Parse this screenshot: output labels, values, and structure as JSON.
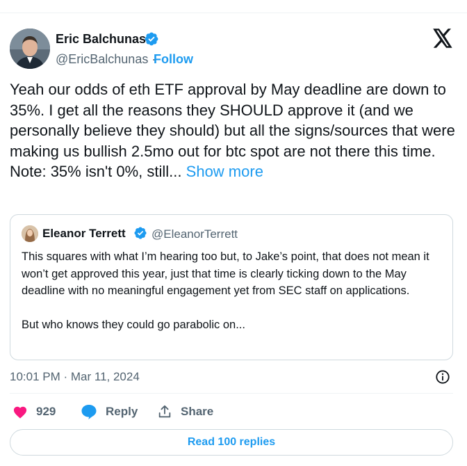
{
  "colors": {
    "accent": "#1d9bf0",
    "text": "#0f1419",
    "secondary": "#536471",
    "like": "#f91880",
    "border": "#cfd9de"
  },
  "author": {
    "name": "Eric Balchunas",
    "handle": "@EricBalchunas",
    "separator": "·",
    "follow_label": "Follow",
    "verified_icon": "verified-badge-icon",
    "avatar_icon": "avatar"
  },
  "logo_icon": "x-logo-icon",
  "tweet": {
    "text": "Yeah our odds of eth ETF approval by May deadline are down to 35%. I get all the reasons they SHOULD approve it (and we personally believe they should) but all the signs/sources that were making us bullish 2.5mo out for btc spot are not there this time. Note: 35% isn't 0%, still...",
    "show_more": "Show more"
  },
  "quote": {
    "name": "Eleanor Terrett",
    "handle": "@EleanorTerrett",
    "text": "This squares with what I’m hearing too but, to Jake’s point, that does not mean it won’t get approved this year, just that time is clearly ticking down to the May deadline with no meaningful engagement yet from SEC staff on applications.\n\nBut who knows they could go parabolic on..."
  },
  "timestamp": "10:01 PM · Mar 11, 2024",
  "info_icon": "info-icon",
  "actions": {
    "like_count": "929",
    "reply_label": "Reply",
    "share_label": "Share"
  },
  "read_replies_label": "Read 100 replies"
}
